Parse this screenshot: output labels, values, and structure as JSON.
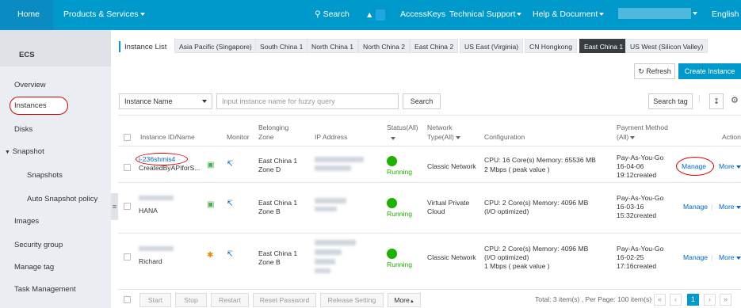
{
  "topbar": {
    "home": "Home",
    "products": "Products & Services",
    "search": "Search",
    "accesskeys": "AccessKeys",
    "support": "Technical Support",
    "help": "Help & Document",
    "lang": "English"
  },
  "sidebar": {
    "title": "ECS",
    "items": [
      "Overview",
      "Instances",
      "Disks",
      "Snapshot",
      "Snapshots",
      "Auto Snapshot policy",
      "Images",
      "Security group",
      "Manage tag",
      "Task Management"
    ]
  },
  "tabs": {
    "label": "Instance List",
    "regions": [
      "Asia Pacific (Singapore)",
      "South China 1",
      "North China 1",
      "North China 2",
      "East China 2",
      "US East (Virginia)",
      "CN Hongkong",
      "East China 1",
      "US West (Silicon Valley)"
    ],
    "current": "East China 1"
  },
  "toolbar": {
    "refresh": "Refresh",
    "create": "Create Instance",
    "filter": "Instance Name",
    "placeholder": "Input instance name for fuzzy query",
    "search": "Search",
    "search_tag": "Search tag"
  },
  "table": {
    "headers": {
      "id": "Instance ID/Name",
      "monitor": "Monitor",
      "zone1": "Belonging",
      "zone2": "Zone",
      "ip": "IP Address",
      "status1": "Status(All)",
      "net1": "Network",
      "net2": "Type(All)",
      "config": "Configuration",
      "pay1": "Payment Method",
      "pay2": "(All)",
      "action": "Action"
    },
    "rows": [
      {
        "id": "i-236shmis4",
        "name": "CreatedByAPIforS...",
        "zone1": "East China 1",
        "zone2": "Zone D",
        "status": "Running",
        "net1": "Classic Network",
        "net2": "",
        "config1": "CPU: 16 Core(s)    Memory: 65536 MB",
        "config2": "2 Mbps ( peak value )",
        "config3": "",
        "pay1": "Pay-As-You-Go",
        "pay2": "16-04-06",
        "pay3": "19:12created",
        "manage": "Manage",
        "more": "More"
      },
      {
        "id": "",
        "name": "HANA",
        "zone1": "East China 1",
        "zone2": "Zone B",
        "status": "Running",
        "net1": "Virtual Private",
        "net2": "Cloud",
        "config1": "CPU: 2 Core(s)    Memory: 4096 MB",
        "config2": "(I/O optimized)",
        "config3": "",
        "pay1": "Pay-As-You-Go",
        "pay2": "16-03-16",
        "pay3": "15:32created",
        "manage": "Manage",
        "more": "More"
      },
      {
        "id": "",
        "name": "Richard",
        "zone1": "East China 1",
        "zone2": "Zone B",
        "status": "Running",
        "net1": "Classic Network",
        "net2": "",
        "config1": "CPU: 2 Core(s)    Memory: 4096 MB",
        "config2": "(I/O optimized)",
        "config3": "1 Mbps ( peak value )",
        "pay1": "Pay-As-You-Go",
        "pay2": "16-02-25",
        "pay3": "17:16created",
        "manage": "Manage",
        "more": "More"
      }
    ]
  },
  "footer": {
    "buttons": [
      "Start",
      "Stop",
      "Restart",
      "Reset Password",
      "Release Setting",
      "More"
    ],
    "total": "Total: 3 item(s) , Per Page: 100 item(s)",
    "page": "1"
  },
  "colors": {
    "topbar": "#0099cc",
    "sidebar": "#eaedf1",
    "running": "#1db100",
    "link": "#0066cc",
    "highlight": "#dd0000"
  }
}
